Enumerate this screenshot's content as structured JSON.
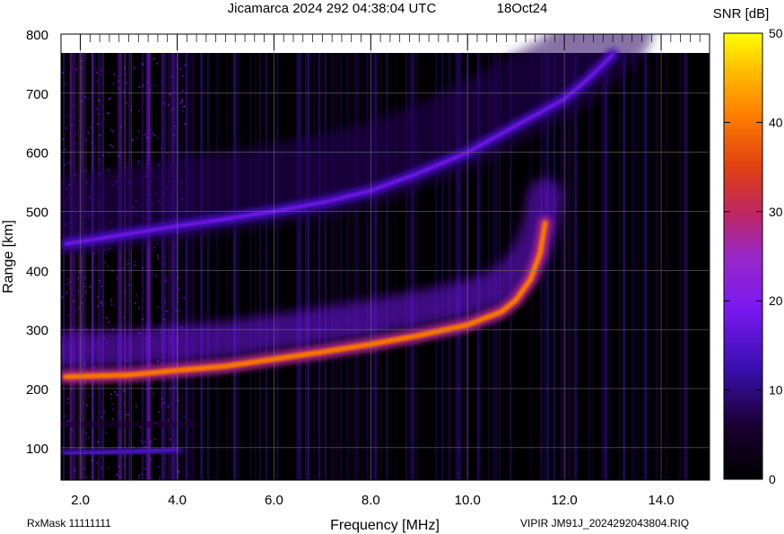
{
  "header": {
    "title": "Jicamarca 2024 292 04:38:04 UTC",
    "date": "18Oct24"
  },
  "footer": {
    "rxmask": "RxMask 11111111",
    "filename": "VIPIR  JM91J_2024292043804.RIQ"
  },
  "chart_data": {
    "type": "heatmap",
    "title": "Jicamarca 2024 292 04:38:04 UTC",
    "xlabel": "Frequency [MHz]",
    "ylabel": "Range [km]",
    "xlim": [
      1.6,
      15.0
    ],
    "ylim": [
      45,
      800
    ],
    "x_ticks": [
      "2.0",
      "4.0",
      "6.0",
      "8.0",
      "10.0",
      "12.0",
      "14.0"
    ],
    "y_ticks": [
      "100",
      "200",
      "300",
      "400",
      "500",
      "600",
      "700",
      "800"
    ],
    "grid": true,
    "colorbar": {
      "label": "SNR [dB]",
      "range": [
        0,
        50
      ],
      "ticks": [
        "0",
        "10",
        "20",
        "30",
        "40",
        "50"
      ]
    },
    "traces": [
      {
        "points": [
          [
            1.7,
            220
          ],
          [
            3.0,
            223
          ],
          [
            4.0,
            231
          ],
          [
            5.0,
            238
          ],
          [
            6.0,
            250
          ],
          [
            7.0,
            262
          ],
          [
            8.0,
            275
          ],
          [
            9.0,
            290
          ],
          [
            10.0,
            308
          ],
          [
            10.7,
            330
          ],
          [
            11.0,
            350
          ],
          [
            11.3,
            385
          ],
          [
            11.5,
            430
          ],
          [
            11.6,
            480
          ]
        ],
        "snr_db": 40
      },
      {
        "points": [
          [
            1.7,
            445
          ],
          [
            3.0,
            462
          ],
          [
            4.0,
            475
          ],
          [
            5.0,
            487
          ],
          [
            6.0,
            500
          ],
          [
            7.0,
            515
          ],
          [
            8.0,
            535
          ],
          [
            9.0,
            565
          ],
          [
            10.0,
            600
          ],
          [
            11.0,
            645
          ],
          [
            12.0,
            690
          ],
          [
            12.5,
            725
          ],
          [
            13.0,
            765
          ]
        ],
        "snr_db": 18
      },
      {
        "points": [
          [
            1.7,
            90
          ],
          [
            2.5,
            92
          ],
          [
            3.5,
            95
          ],
          [
            4.0,
            97
          ]
        ],
        "snr_db": 14
      }
    ]
  }
}
